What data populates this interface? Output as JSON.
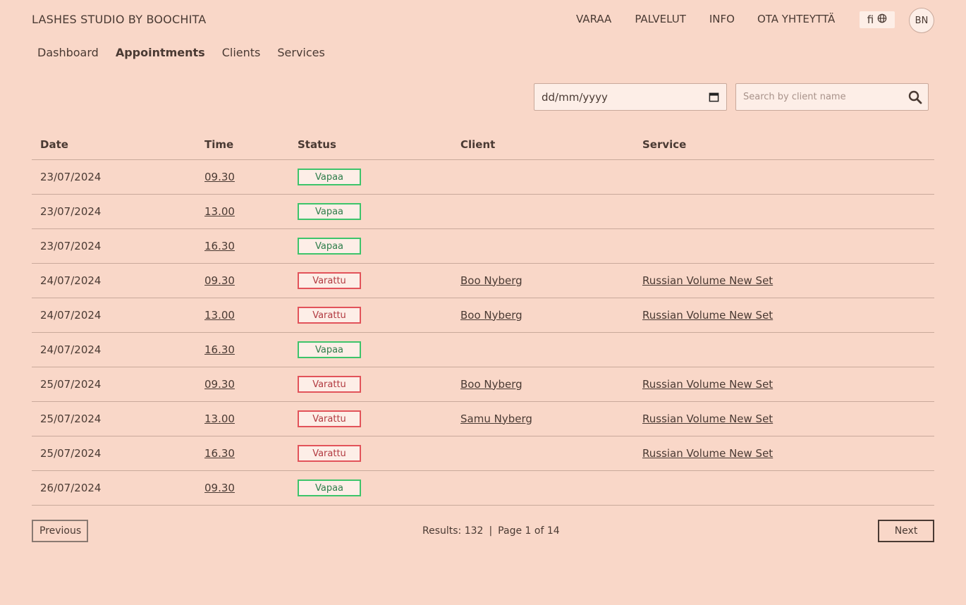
{
  "brand": "LASHES STUDIO BY BOOCHITA",
  "topnav": {
    "book": "VARAA",
    "services": "PALVELUT",
    "info": "INFO",
    "contact": "OTA YHTEYTTÄ",
    "lang": "fi",
    "avatar": "BN"
  },
  "subnav": {
    "dashboard": "Dashboard",
    "appointments": "Appointments",
    "clients": "Clients",
    "services": "Services"
  },
  "filters": {
    "date_value": "dd/mm/yyyy",
    "search_placeholder": "Search by client name"
  },
  "table": {
    "headers": {
      "date": "Date",
      "time": "Time",
      "status": "Status",
      "client": "Client",
      "service": "Service"
    },
    "rows": [
      {
        "date": "23/07/2024",
        "time": "09.30",
        "status": "Vapaa",
        "state": "free",
        "client": "",
        "service": ""
      },
      {
        "date": "23/07/2024",
        "time": "13.00",
        "status": "Vapaa",
        "state": "free",
        "client": "",
        "service": ""
      },
      {
        "date": "23/07/2024",
        "time": "16.30",
        "status": "Vapaa",
        "state": "free",
        "client": "",
        "service": ""
      },
      {
        "date": "24/07/2024",
        "time": "09.30",
        "status": "Varattu",
        "state": "booked",
        "client": "Boo Nyberg",
        "service": "Russian Volume New Set"
      },
      {
        "date": "24/07/2024",
        "time": "13.00",
        "status": "Varattu",
        "state": "booked",
        "client": "Boo Nyberg",
        "service": "Russian Volume New Set"
      },
      {
        "date": "24/07/2024",
        "time": "16.30",
        "status": "Vapaa",
        "state": "free",
        "client": "",
        "service": ""
      },
      {
        "date": "25/07/2024",
        "time": "09.30",
        "status": "Varattu",
        "state": "booked",
        "client": "Boo Nyberg",
        "service": "Russian Volume New Set"
      },
      {
        "date": "25/07/2024",
        "time": "13.00",
        "status": "Varattu",
        "state": "booked",
        "client": "Samu Nyberg",
        "service": "Russian Volume New Set"
      },
      {
        "date": "25/07/2024",
        "time": "16.30",
        "status": "Varattu",
        "state": "booked",
        "client": "",
        "service": "Russian Volume New Set"
      },
      {
        "date": "26/07/2024",
        "time": "09.30",
        "status": "Vapaa",
        "state": "free",
        "client": "",
        "service": ""
      }
    ]
  },
  "pagination": {
    "previous": "Previous",
    "next": "Next",
    "results": "Results: 132",
    "page": "Page 1 of 14"
  }
}
